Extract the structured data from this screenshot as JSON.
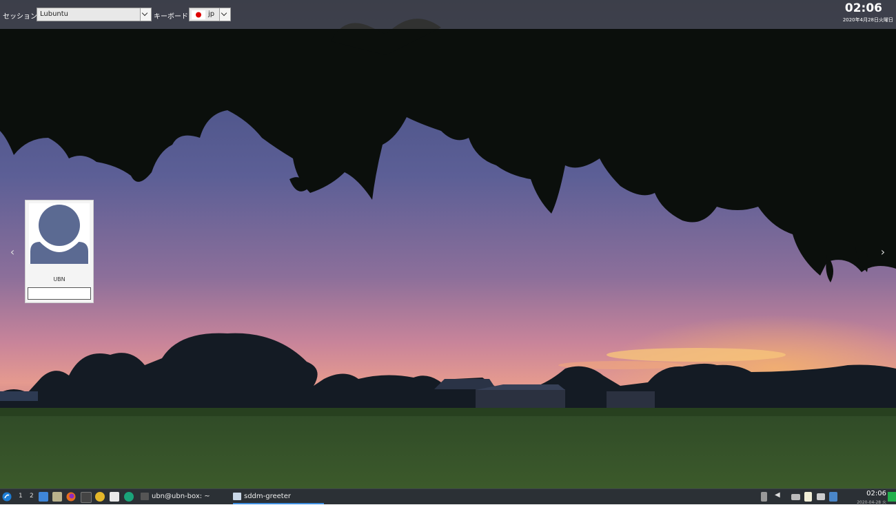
{
  "greeter": {
    "session_label": "セッション",
    "session_value": "Lubuntu",
    "keyboard_label": "キーボード",
    "keyboard_value": "jp",
    "clock": "02:06",
    "date": "2020年4月28日火曜日"
  },
  "login": {
    "user_name": "UBN",
    "password_value": ""
  },
  "taskbar": {
    "desktops": [
      "1",
      "2"
    ],
    "tasks": [
      {
        "label": "ubn@ubn-box: ~"
      },
      {
        "label": "sddm-greeter"
      }
    ],
    "clock": "02:06",
    "date": "2020-04-28 火"
  },
  "icons": {
    "start": "lubuntu-logo-icon",
    "file-manager": "folder-icon",
    "firefox": "firefox-icon",
    "flag": "japan-flag-icon"
  },
  "colors": {
    "topbar": "#3c3c3c",
    "taskbar": "#2b3035",
    "accent": "#3d8ee0"
  }
}
